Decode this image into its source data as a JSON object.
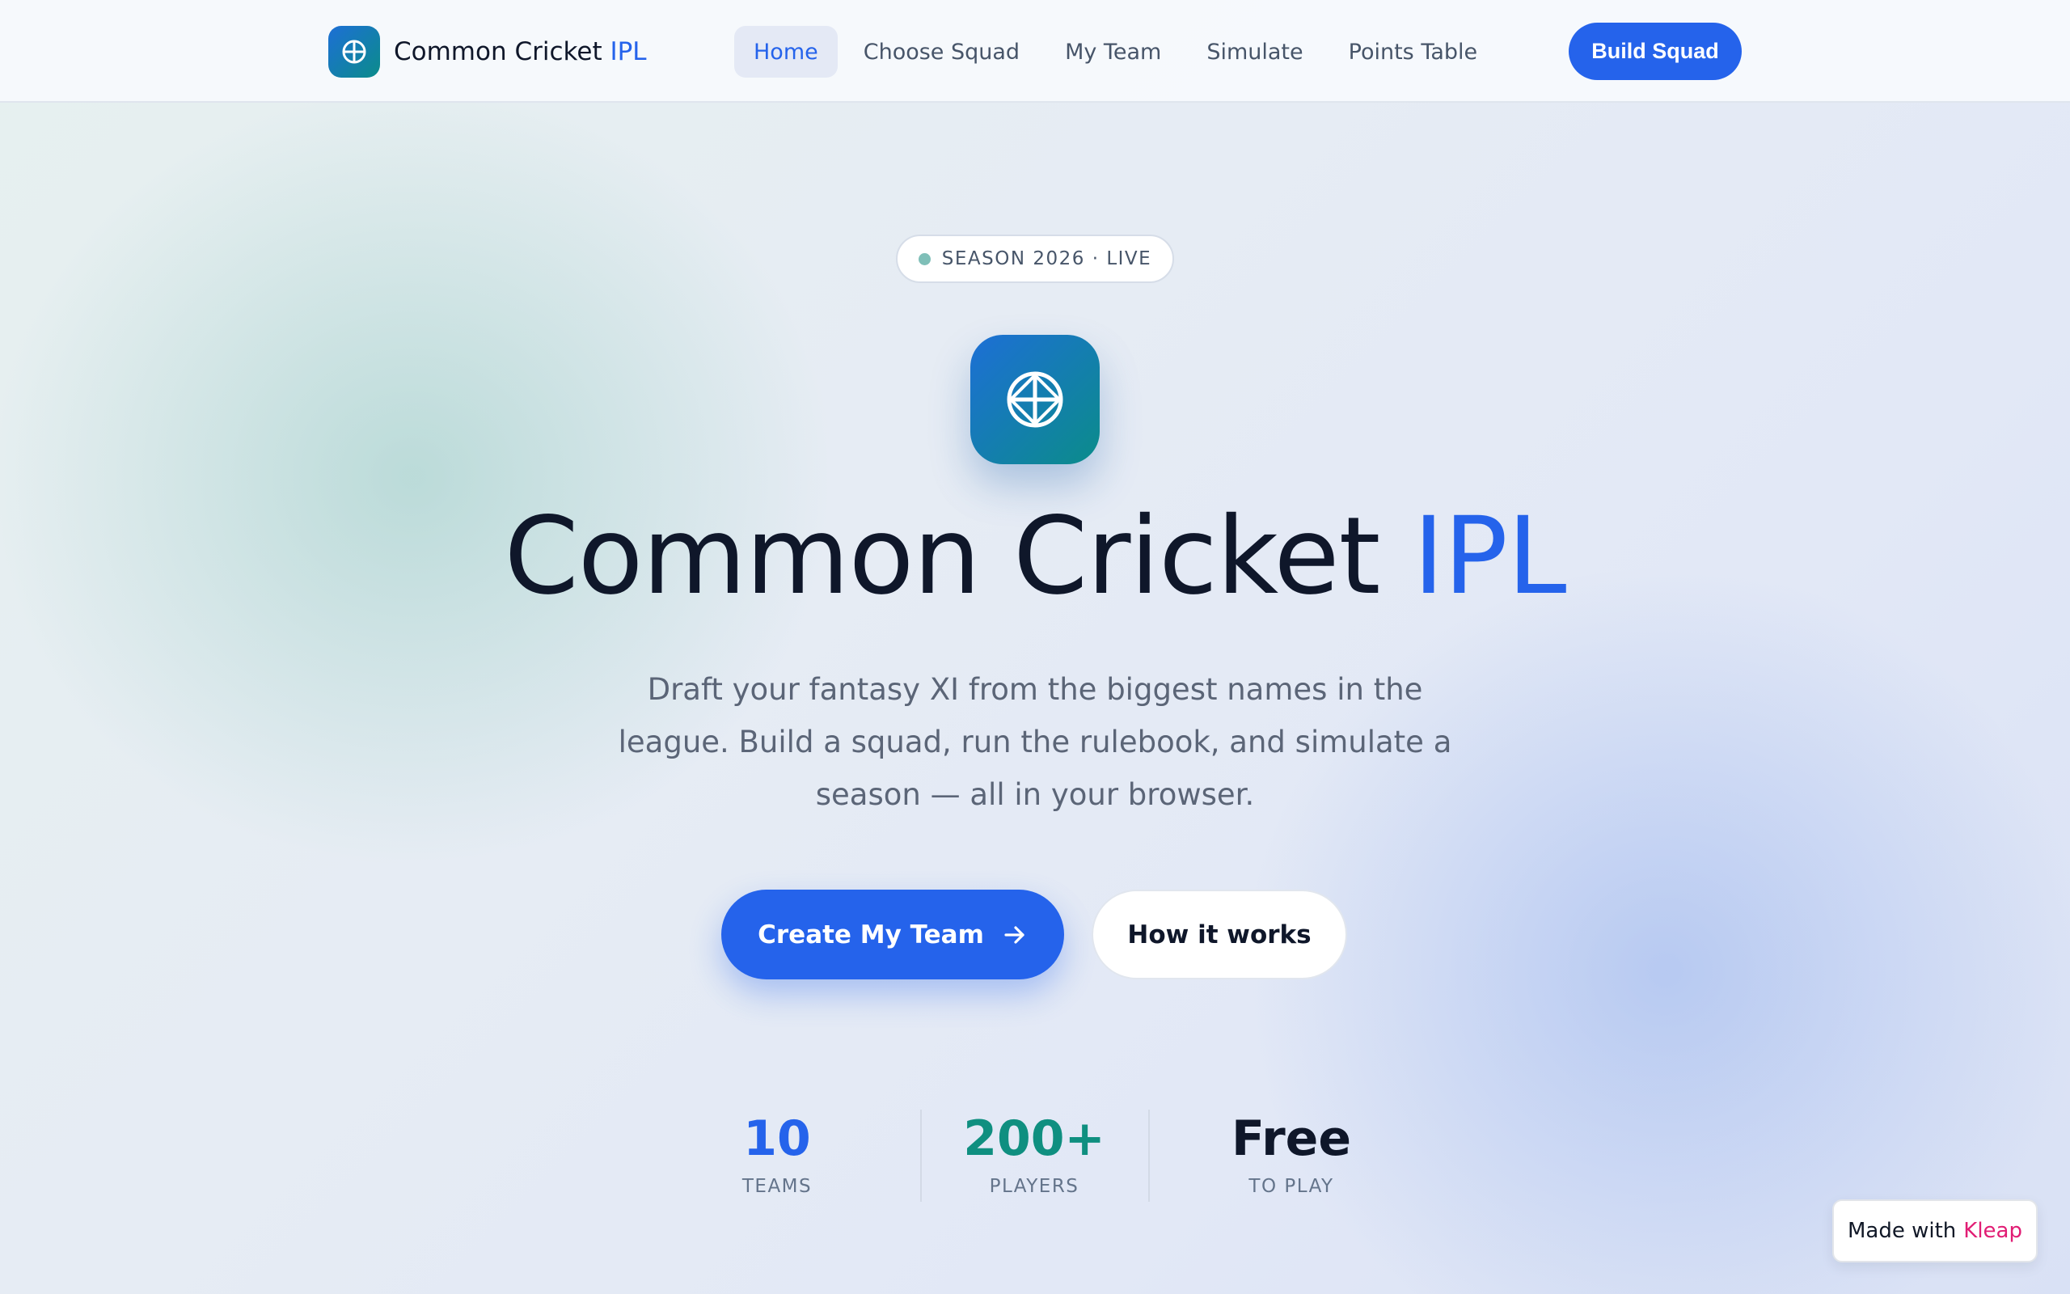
{
  "colors": {
    "primary": "#2563eb",
    "teal": "#0f8f80",
    "text_dark": "#0f172a",
    "text_muted": "#5b6577",
    "kleap_pink": "#e11d74"
  },
  "nav": {
    "brand_main": "Common Cricket",
    "brand_accent": "IPL",
    "brand_icon": "cricket-ball-icon",
    "links": [
      {
        "label": "Home",
        "active": true
      },
      {
        "label": "Choose Squad",
        "active": false
      },
      {
        "label": "My Team",
        "active": false
      },
      {
        "label": "Simulate",
        "active": false
      },
      {
        "label": "Points Table",
        "active": false
      }
    ],
    "cta_label": "Build Squad"
  },
  "hero": {
    "badge": "SEASON 2026 · LIVE",
    "logo_icon": "cricket-ball-icon",
    "title_main": "Common Cricket",
    "title_accent": "IPL",
    "subtitle": "Draft your fantasy XI from the biggest names in the league. Build a squad, run the rulebook, and simulate a season — all in your browser.",
    "primary_button": "Create My Team",
    "primary_button_icon": "arrow-right-icon",
    "secondary_button": "How it works"
  },
  "stats": [
    {
      "value": "10",
      "label": "TEAMS",
      "color": "#2563eb"
    },
    {
      "value": "200+",
      "label": "PLAYERS",
      "color": "#0f8f80"
    },
    {
      "value": "Free",
      "label": "TO PLAY",
      "color": "#0f172a"
    }
  ],
  "footer": {
    "made_with": "Made with",
    "brand": "Kleap"
  }
}
